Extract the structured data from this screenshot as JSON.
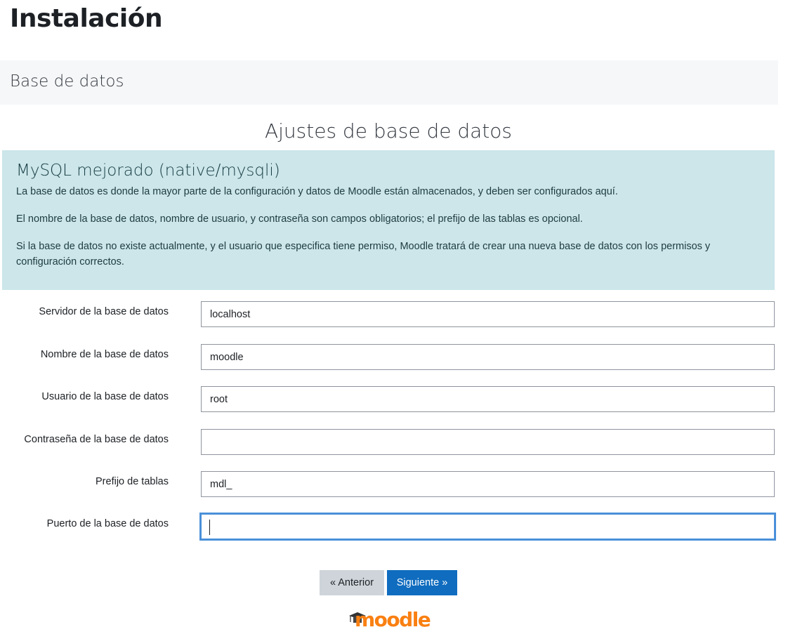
{
  "page": {
    "title": "Instalación",
    "stage": "Base de datos",
    "settings_heading": "Ajustes de base de datos"
  },
  "info": {
    "driver_title": "MySQL mejorado (native/mysqli)",
    "paragraphs": [
      "La base de datos es donde la mayor parte de la configuración y datos de Moodle están almacenados, y deben ser configurados aquí.",
      "El nombre de la base de datos, nombre de usuario, y contraseña son campos obligatorios; el prefijo de las tablas es opcional.",
      "Si la base de datos no existe actualmente, y el usuario que especifica tiene permiso, Moodle tratará de crear una nueva base de datos con los permisos y configuración correctos."
    ]
  },
  "form": {
    "fields": [
      {
        "label": "Servidor de la base de datos",
        "value": "localhost"
      },
      {
        "label": "Nombre de la base de datos",
        "value": "moodle"
      },
      {
        "label": "Usuario de la base de datos",
        "value": "root"
      },
      {
        "label": "Contraseña de la base de datos",
        "value": ""
      },
      {
        "label": "Prefijo de tablas",
        "value": "mdl_"
      },
      {
        "label": "Puerto de la base de datos",
        "value": ""
      }
    ]
  },
  "buttons": {
    "previous": "« Anterior",
    "next": "Siguiente »"
  },
  "logo": {
    "text": "moodle",
    "color": "#f98012",
    "cap_color": "#333333"
  },
  "colors": {
    "info_bg": "#cce6ea",
    "primary": "#0f6cbf",
    "focus_border": "#4a90d9"
  }
}
